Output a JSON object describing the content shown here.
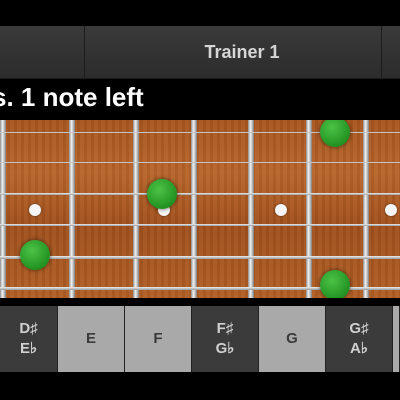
{
  "header": {
    "title": "Trainer 1"
  },
  "message": {
    "text": "s. 1 note left"
  },
  "fretboard": {
    "string_count": 6,
    "colors": {
      "wood": "#b0602a",
      "note_dot": "#2ea52a",
      "inlay": "#f5f5f5"
    }
  },
  "note_buttons": [
    {
      "top": "D♯",
      "bottom": "E♭",
      "type": "accidental"
    },
    {
      "top": "E",
      "bottom": "",
      "type": "natural"
    },
    {
      "top": "F",
      "bottom": "",
      "type": "natural"
    },
    {
      "top": "F♯",
      "bottom": "G♭",
      "type": "accidental"
    },
    {
      "top": "G",
      "bottom": "",
      "type": "natural"
    },
    {
      "top": "G♯",
      "bottom": "A♭",
      "type": "accidental"
    },
    {
      "top": "",
      "bottom": "",
      "type": "natural"
    }
  ]
}
